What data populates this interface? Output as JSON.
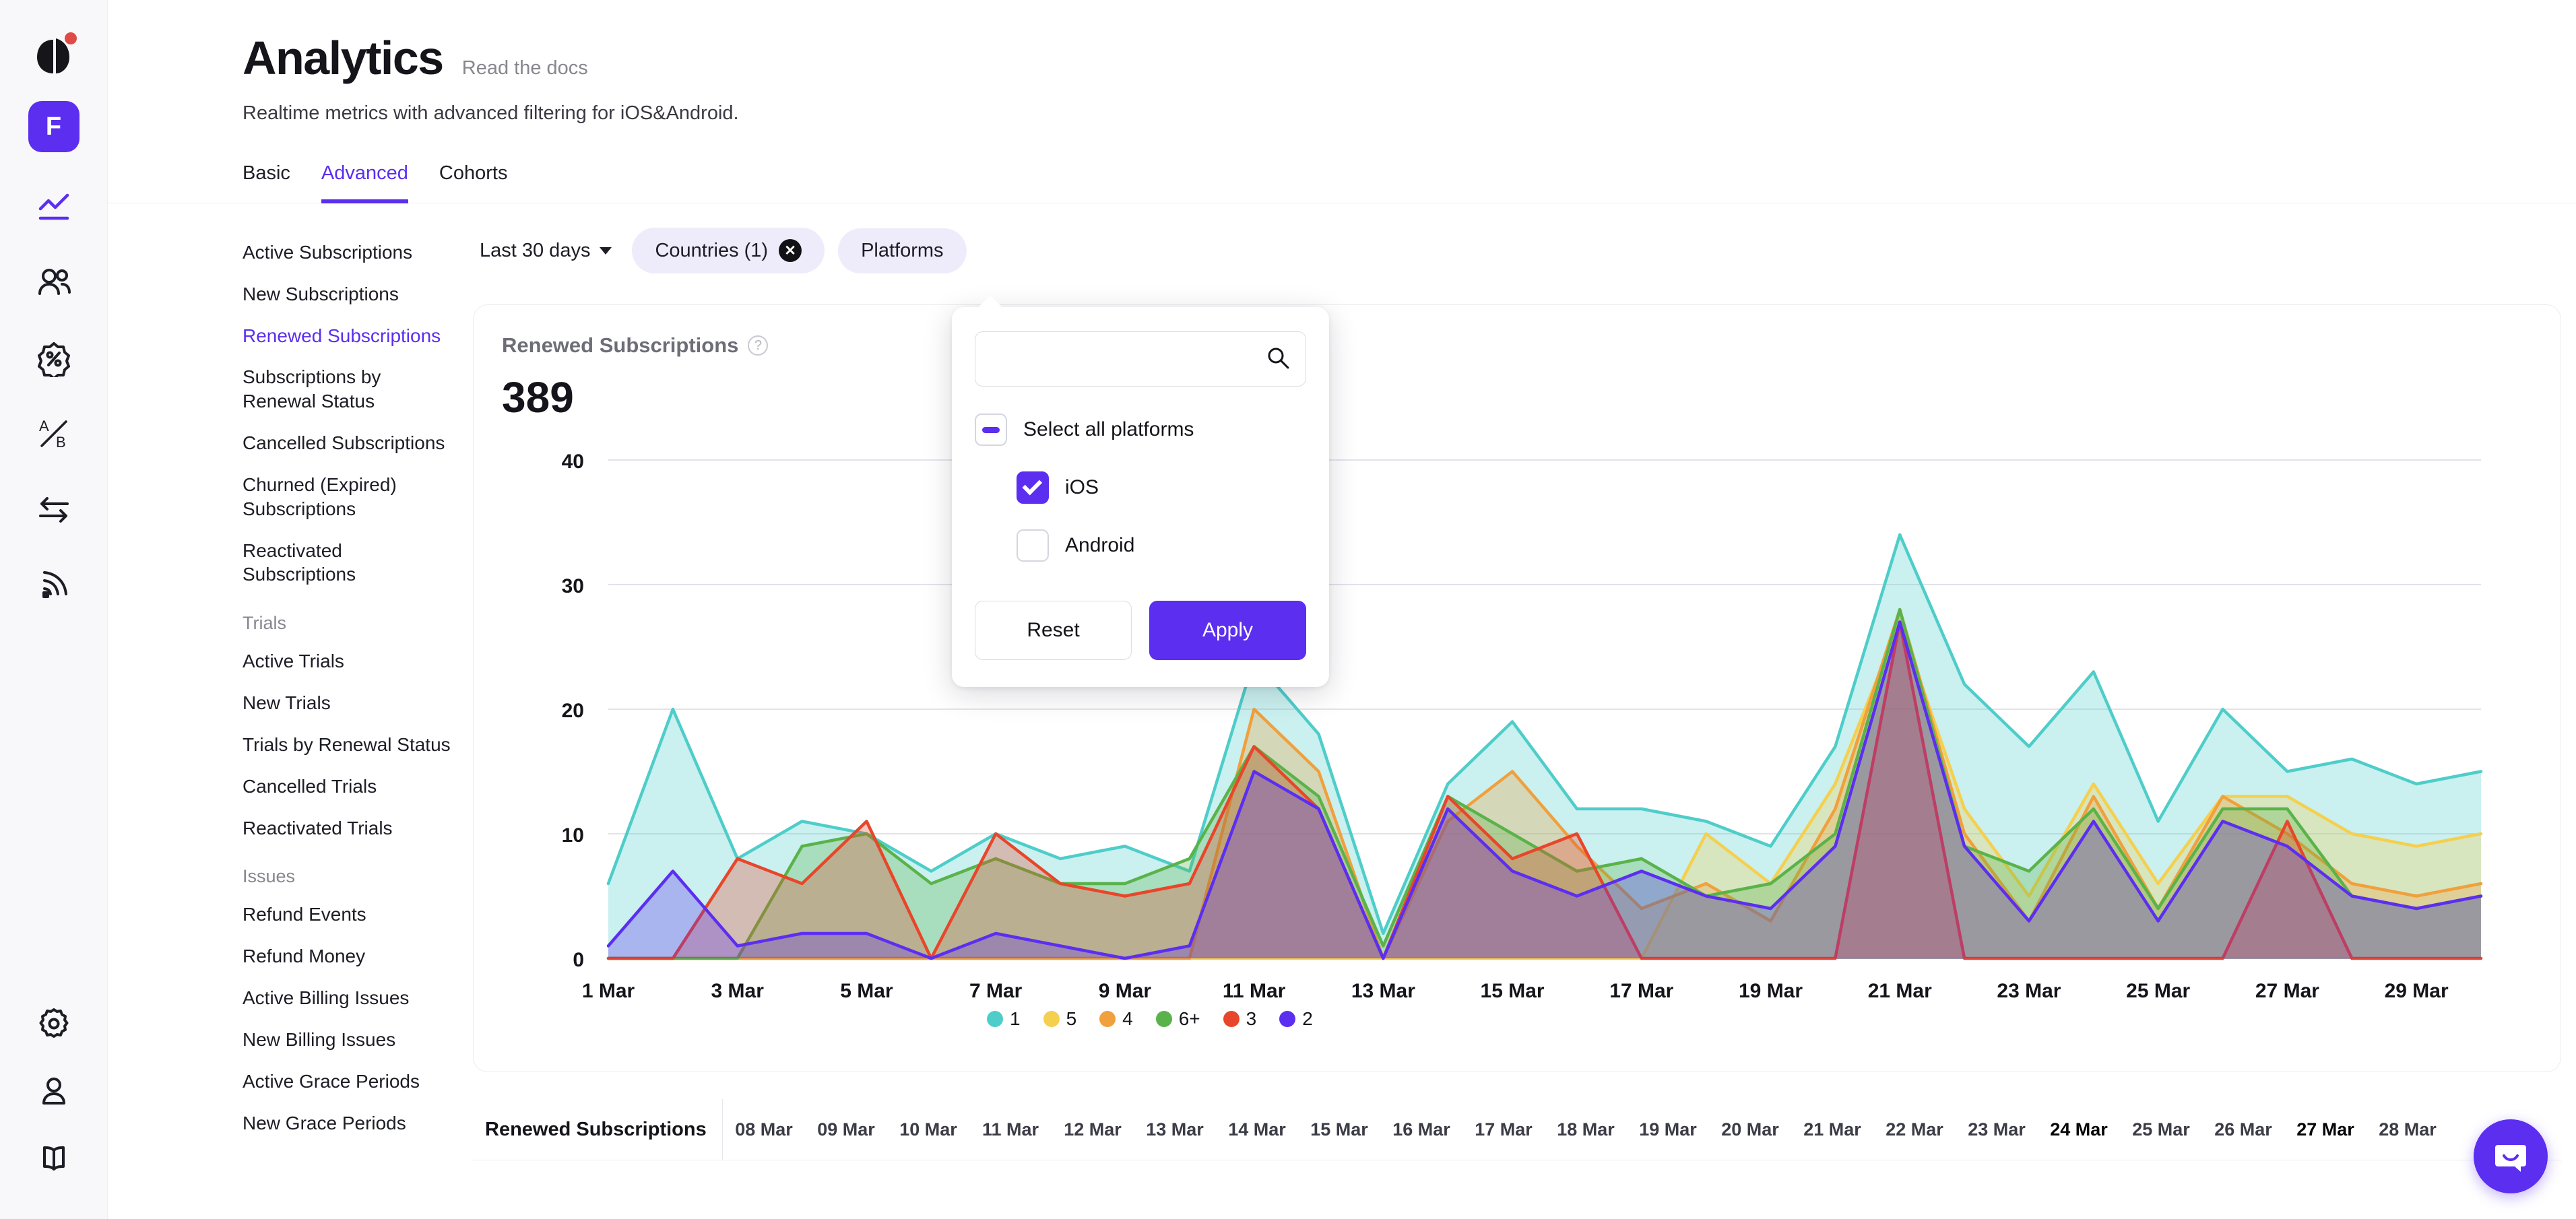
{
  "rail": {
    "logo_icon": "brand-leaf-logo",
    "avatar_initial": "F",
    "icons": [
      {
        "name": "analytics-line-chart-icon",
        "active": true
      },
      {
        "name": "users-icon",
        "active": false
      },
      {
        "name": "discount-badge-icon",
        "active": false
      },
      {
        "name": "ab-test-icon",
        "active": false
      },
      {
        "name": "transfer-arrows-icon",
        "active": false
      },
      {
        "name": "broadcast-icon",
        "active": false
      }
    ],
    "bottom_icons": [
      {
        "name": "gear-icon"
      },
      {
        "name": "person-icon"
      },
      {
        "name": "book-icon"
      }
    ]
  },
  "header": {
    "title": "Analytics",
    "docs_link": "Read the docs",
    "subtitle": "Realtime metrics with advanced filtering for iOS&Android."
  },
  "tabs": [
    {
      "label": "Basic",
      "active": false
    },
    {
      "label": "Advanced",
      "active": true
    },
    {
      "label": "Cohorts",
      "active": false
    }
  ],
  "nav": [
    {
      "label": "Active Subscriptions",
      "type": "item",
      "active": false
    },
    {
      "label": "New Subscriptions",
      "type": "item",
      "active": false
    },
    {
      "label": "Renewed Subscriptions",
      "type": "item",
      "active": true
    },
    {
      "label": "Subscriptions by Renewal Status",
      "type": "item",
      "active": false
    },
    {
      "label": "Cancelled Subscriptions",
      "type": "item",
      "active": false
    },
    {
      "label": "Churned (Expired) Subscriptions",
      "type": "item",
      "active": false
    },
    {
      "label": "Reactivated Subscriptions",
      "type": "item",
      "active": false
    },
    {
      "label": "Trials",
      "type": "group"
    },
    {
      "label": "Active Trials",
      "type": "item",
      "active": false
    },
    {
      "label": "New Trials",
      "type": "item",
      "active": false
    },
    {
      "label": "Trials by Renewal Status",
      "type": "item",
      "active": false
    },
    {
      "label": "Cancelled Trials",
      "type": "item",
      "active": false
    },
    {
      "label": "Reactivated Trials",
      "type": "item",
      "active": false
    },
    {
      "label": "Issues",
      "type": "group"
    },
    {
      "label": "Refund Events",
      "type": "item",
      "active": false
    },
    {
      "label": "Refund Money",
      "type": "item",
      "active": false
    },
    {
      "label": "Active Billing Issues",
      "type": "item",
      "active": false
    },
    {
      "label": "New Billing Issues",
      "type": "item",
      "active": false
    },
    {
      "label": "Active Grace Periods",
      "type": "item",
      "active": false
    },
    {
      "label": "New Grace Periods",
      "type": "item",
      "active": false
    }
  ],
  "filters": {
    "date_range": "Last 30 days",
    "chips": [
      {
        "label": "Countries (1)",
        "removable": true
      },
      {
        "label": "Platforms",
        "removable": false
      }
    ]
  },
  "platform_popover": {
    "search_placeholder": "",
    "search_value": "",
    "search_icon": "search-icon",
    "select_all_label": "Select all platforms",
    "select_all_state": "indeterminate",
    "options": [
      {
        "label": "iOS",
        "checked": true
      },
      {
        "label": "Android",
        "checked": false
      }
    ],
    "reset_label": "Reset",
    "apply_label": "Apply"
  },
  "card": {
    "title": "Renewed Subscriptions",
    "help_icon": "question-mark-icon",
    "value": "389"
  },
  "table": {
    "first_col_header": "Renewed Subscriptions",
    "date_headers": [
      {
        "label": "08 Mar",
        "strong": false
      },
      {
        "label": "09 Mar",
        "strong": false
      },
      {
        "label": "10 Mar",
        "strong": false
      },
      {
        "label": "11 Mar",
        "strong": false
      },
      {
        "label": "12 Mar",
        "strong": false
      },
      {
        "label": "13 Mar",
        "strong": false
      },
      {
        "label": "14 Mar",
        "strong": false
      },
      {
        "label": "15 Mar",
        "strong": false
      },
      {
        "label": "16 Mar",
        "strong": false
      },
      {
        "label": "17 Mar",
        "strong": false
      },
      {
        "label": "18 Mar",
        "strong": false
      },
      {
        "label": "19 Mar",
        "strong": false
      },
      {
        "label": "20 Mar",
        "strong": false
      },
      {
        "label": "21 Mar",
        "strong": false
      },
      {
        "label": "22 Mar",
        "strong": false
      },
      {
        "label": "23 Mar",
        "strong": false
      },
      {
        "label": "24 Mar",
        "strong": true
      },
      {
        "label": "25 Mar",
        "strong": false
      },
      {
        "label": "26 Mar",
        "strong": false
      },
      {
        "label": "27 Mar",
        "strong": true
      },
      {
        "label": "28 Mar",
        "strong": false
      }
    ]
  },
  "intercom": {
    "icon": "chat-bubble-smile-icon"
  },
  "colors": {
    "accent": "#5b2ef0",
    "series_1": "#4ecdc9",
    "series_5": "#f5cf4e",
    "series_4": "#f0a03c",
    "series_6plus": "#5ab34a",
    "series_3": "#e8462a",
    "series_2": "#5b2ef0"
  },
  "chart_data": {
    "type": "area",
    "title": "Renewed Subscriptions",
    "xlabel": "",
    "ylabel": "",
    "ylim": [
      0,
      40
    ],
    "yticks": [
      0,
      10,
      20,
      30,
      40
    ],
    "grid": true,
    "legend_position": "bottom-left",
    "stacked": false,
    "x": [
      "1 Mar",
      "2 Mar",
      "3 Mar",
      "4 Mar",
      "5 Mar",
      "6 Mar",
      "7 Mar",
      "8 Mar",
      "9 Mar",
      "10 Mar",
      "11 Mar",
      "12 Mar",
      "13 Mar",
      "14 Mar",
      "15 Mar",
      "16 Mar",
      "17 Mar",
      "18 Mar",
      "19 Mar",
      "20 Mar",
      "21 Mar",
      "22 Mar",
      "23 Mar",
      "24 Mar",
      "25 Mar",
      "26 Mar",
      "27 Mar",
      "28 Mar",
      "29 Mar",
      "30 Mar"
    ],
    "xtick_labels": [
      "1 Mar",
      "3 Mar",
      "5 Mar",
      "7 Mar",
      "9 Mar",
      "11 Mar",
      "13 Mar",
      "15 Mar",
      "17 Mar",
      "19 Mar",
      "21 Mar",
      "23 Mar",
      "25 Mar",
      "27 Mar",
      "29 Mar"
    ],
    "series": [
      {
        "name": "1",
        "color": "#4ecdc9",
        "values": [
          6,
          20,
          8,
          11,
          10,
          7,
          10,
          8,
          9,
          7,
          24,
          18,
          2,
          14,
          19,
          12,
          12,
          11,
          9,
          17,
          34,
          22,
          17,
          23,
          11,
          20,
          15,
          16,
          14,
          15
        ]
      },
      {
        "name": "5",
        "color": "#f5cf4e",
        "values": [
          0,
          0,
          0,
          0,
          0,
          0,
          0,
          0,
          0,
          0,
          0,
          0,
          0,
          0,
          0,
          0,
          0,
          10,
          6,
          14,
          27,
          12,
          5,
          14,
          6,
          13,
          13,
          10,
          9,
          10
        ]
      },
      {
        "name": "4",
        "color": "#f0a03c",
        "values": [
          0,
          0,
          0,
          0,
          0,
          0,
          0,
          0,
          0,
          0,
          20,
          15,
          0,
          11,
          15,
          9,
          4,
          6,
          3,
          12,
          28,
          10,
          3,
          13,
          4,
          13,
          10,
          6,
          5,
          6
        ]
      },
      {
        "name": "6+",
        "color": "#5ab34a",
        "values": [
          0,
          0,
          0,
          9,
          10,
          6,
          8,
          6,
          6,
          8,
          17,
          13,
          1,
          13,
          10,
          7,
          8,
          5,
          6,
          10,
          28,
          9,
          7,
          12,
          4,
          12,
          12,
          5,
          4,
          5
        ]
      },
      {
        "name": "3",
        "color": "#e8462a",
        "values": [
          0,
          0,
          8,
          6,
          11,
          0,
          10,
          6,
          5,
          6,
          17,
          12,
          0,
          13,
          8,
          10,
          0,
          0,
          0,
          0,
          27,
          0,
          0,
          0,
          0,
          0,
          11,
          0,
          0,
          0
        ]
      },
      {
        "name": "2",
        "color": "#5b2ef0",
        "values": [
          1,
          7,
          1,
          2,
          2,
          0,
          2,
          1,
          0,
          1,
          15,
          12,
          0,
          12,
          7,
          5,
          7,
          5,
          4,
          9,
          27,
          9,
          3,
          11,
          3,
          11,
          9,
          5,
          4,
          5
        ]
      }
    ]
  }
}
